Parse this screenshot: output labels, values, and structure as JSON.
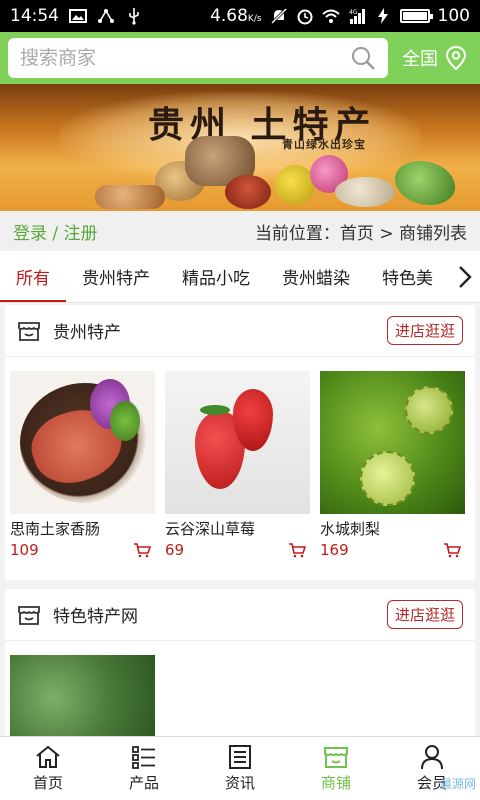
{
  "status_bar": {
    "time": "14:54",
    "speed": "4.68",
    "speed_unit": "K/s",
    "network": "4G",
    "battery": "100",
    "battery_level": 1.0
  },
  "search": {
    "placeholder": "搜索商家",
    "region_label": "全国"
  },
  "banner": {
    "title": "贵州 土特产",
    "subtitle": "青山绿水出珍宝"
  },
  "breadcrumb": {
    "login": "登录 / 注册",
    "location": "当前位置：首页 > 商铺列表"
  },
  "tabs": [
    {
      "label": "所有",
      "active": true
    },
    {
      "label": "贵州特产",
      "active": false
    },
    {
      "label": "精品小吃",
      "active": false
    },
    {
      "label": "贵州蜡染",
      "active": false
    },
    {
      "label": "特色美",
      "active": false
    }
  ],
  "shops": [
    {
      "name": "贵州特产",
      "visit_label": "进店逛逛",
      "products": [
        {
          "name": "思南土家香肠",
          "price": "109",
          "image": "sausage"
        },
        {
          "name": "云谷深山草莓",
          "price": "69",
          "image": "strawberry"
        },
        {
          "name": "水城刺梨",
          "price": "169",
          "image": "prickly-pear"
        }
      ]
    },
    {
      "name": "特色特产网",
      "visit_label": "进店逛逛",
      "products": [
        {
          "name": "",
          "price": "",
          "image": "tree"
        }
      ]
    }
  ],
  "bottom_nav": [
    {
      "label": "首页",
      "icon": "home-icon",
      "active": false
    },
    {
      "label": "产品",
      "icon": "list-icon",
      "active": false
    },
    {
      "label": "资讯",
      "icon": "news-icon",
      "active": false
    },
    {
      "label": "商铺",
      "icon": "store-icon",
      "active": true
    },
    {
      "label": "会员",
      "icon": "user-icon",
      "active": false
    }
  ],
  "colors": {
    "header_green": "#7fd15a",
    "accent_red": "#c21a1a",
    "nav_active": "#6fc24a"
  },
  "watermark": "晨源网"
}
